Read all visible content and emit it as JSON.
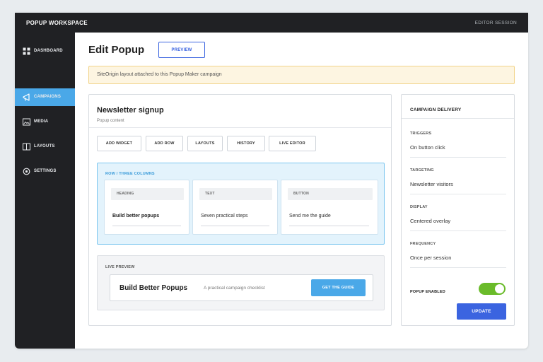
{
  "app": {
    "title": "POPUP WORKSPACE",
    "session": "EDITOR SESSION"
  },
  "sidebar": {
    "items": [
      {
        "label": "DASHBOARD",
        "icon": "grid-icon",
        "active": false
      },
      {
        "label": "CAMPAIGNS",
        "icon": "megaphone-icon",
        "active": true
      },
      {
        "label": "MEDIA",
        "icon": "image-icon",
        "active": false
      },
      {
        "label": "LAYOUTS",
        "icon": "columns-icon",
        "active": false
      },
      {
        "label": "SETTINGS",
        "icon": "settings-icon",
        "active": false
      }
    ]
  },
  "header": {
    "title": "Edit Popup",
    "preview_label": "PREVIEW"
  },
  "notice": {
    "text": "SiteOrigin layout attached to this Popup Maker campaign"
  },
  "editor": {
    "title": "Newsletter signup",
    "subtitle": "Popup content",
    "toolbar": [
      "ADD WIDGET",
      "ADD ROW",
      "LAYOUTS",
      "HISTORY",
      "LIVE EDITOR"
    ],
    "row_label": "ROW  /  THREE COLUMNS",
    "widgets": [
      {
        "tag": "HEADING",
        "text": "Build better popups"
      },
      {
        "tag": "TEXT",
        "text": "Seven practical steps"
      },
      {
        "tag": "BUTTON",
        "text": "Send me the guide"
      }
    ],
    "live_preview": {
      "label": "LIVE PREVIEW",
      "title": "Build Better Popups",
      "subtitle": "A practical campaign checklist",
      "cta": "GET THE GUIDE"
    }
  },
  "delivery": {
    "title": "CAMPAIGN DELIVERY",
    "fields": [
      {
        "label": "TRIGGERS",
        "value": "On button click"
      },
      {
        "label": "TARGETING",
        "value": "Newsletter visitors"
      },
      {
        "label": "DISPLAY",
        "value": "Centered overlay"
      },
      {
        "label": "FREQUENCY",
        "value": "Once per session"
      }
    ],
    "enabled_label": "POPUP ENABLED",
    "enabled": true,
    "update_label": "UPDATE"
  },
  "colors": {
    "accent": "#4aa8e8",
    "primary": "#3b64e0",
    "toggle_on": "#6abb2a",
    "sidebar_bg": "#202124",
    "notice_bg": "#fdf5e1"
  }
}
